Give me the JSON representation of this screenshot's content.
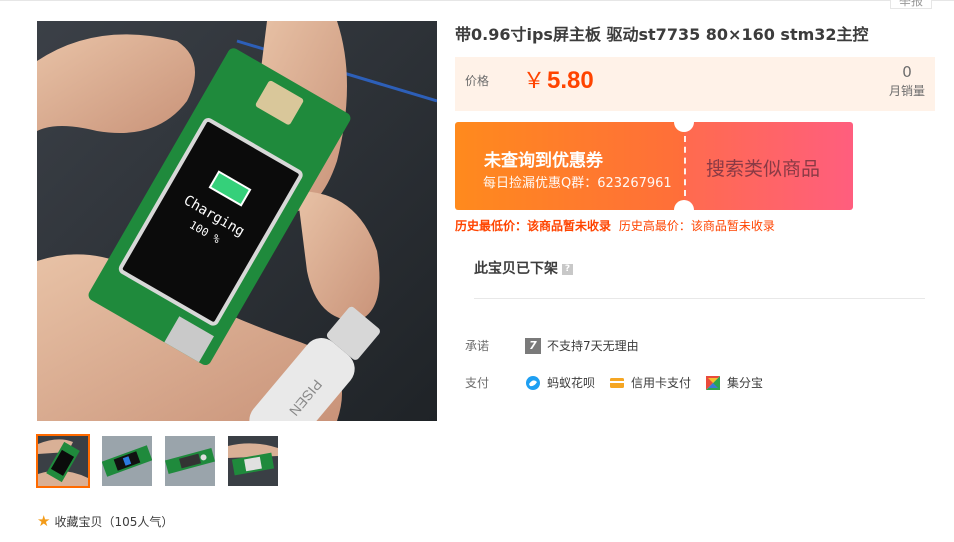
{
  "header": {
    "report_label": "举报"
  },
  "product": {
    "title": "带0.96寸ips屏主板 驱动st7735 80×160 stm32主控",
    "price_label": "价格",
    "currency": "￥",
    "price": "5.80",
    "monthly_sales_count": "0",
    "monthly_sales_label": "月销量"
  },
  "main_image": {
    "screen_line1": "Charging",
    "screen_line2": "100 %",
    "cable_text": "PISEN"
  },
  "coupon": {
    "title": "未查询到优惠券",
    "subtitle": "每日捡漏优惠Q群：623267961",
    "search_label": "搜索类似商品"
  },
  "history": {
    "low_label": "历史最低价：该商品暂未收录",
    "high_label": "历史高最价：该商品暂未收录"
  },
  "status": {
    "off_shelf": "此宝贝已下架",
    "help_mark": "?"
  },
  "promise": {
    "label": "承诺",
    "badge": "7",
    "text": "不支持7天无理由"
  },
  "payment": {
    "label": "支付",
    "methods": [
      {
        "name": "蚂蚁花呗",
        "icon": "huabei-icon"
      },
      {
        "name": "信用卡支付",
        "icon": "credit-card-icon"
      },
      {
        "name": "集分宝",
        "icon": "jifenbao-icon"
      }
    ]
  },
  "favorite": {
    "label": "收藏宝贝",
    "count_text": "（105人气）"
  },
  "colors": {
    "accent": "#ff4400",
    "price_bg": "#fff2e8",
    "coupon_orange": "#ff8a1d",
    "coupon_pink": "#ff5e7e"
  }
}
